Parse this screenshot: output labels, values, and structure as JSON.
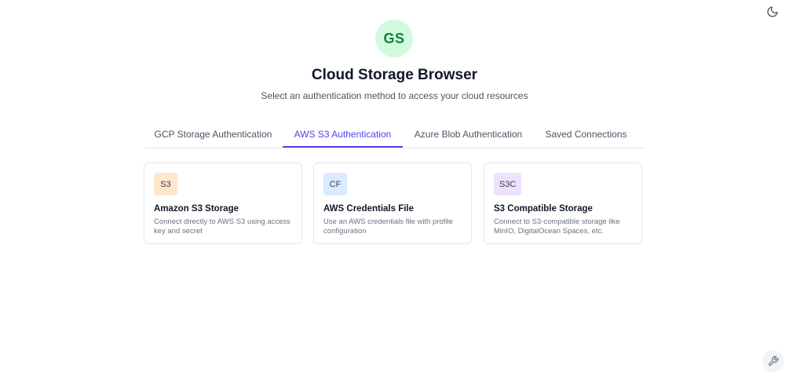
{
  "header": {
    "avatar_initials": "GS",
    "title": "Cloud Storage Browser",
    "subtitle": "Select an authentication method to access your cloud resources"
  },
  "tabs": [
    {
      "label": "GCP Storage Authentication",
      "active": false
    },
    {
      "label": "AWS S3 Authentication",
      "active": true
    },
    {
      "label": "Azure Blob Authentication",
      "active": false
    },
    {
      "label": "Saved Connections",
      "active": false
    }
  ],
  "cards": [
    {
      "badge": "S3",
      "title": "Amazon S3 Storage",
      "description": "Connect directly to AWS S3 using access key and secret",
      "badge_color": "#fde8cc"
    },
    {
      "badge": "CF",
      "title": "AWS Credentials File",
      "description": "Use an AWS credentials file with profile configuration",
      "badge_color": "#dbeafe"
    },
    {
      "badge": "S3C",
      "title": "S3 Compatible Storage",
      "description": "Connect to S3-compatible storage like MinIO, DigitalOcean Spaces, etc.",
      "badge_color": "#ede3fb"
    }
  ],
  "icons": {
    "theme_toggle": "moon-icon",
    "tool_button": "wrench-icon"
  },
  "colors": {
    "accent": "#4f46e5",
    "avatar_bg": "#d1fadf",
    "avatar_text": "#15803d"
  }
}
